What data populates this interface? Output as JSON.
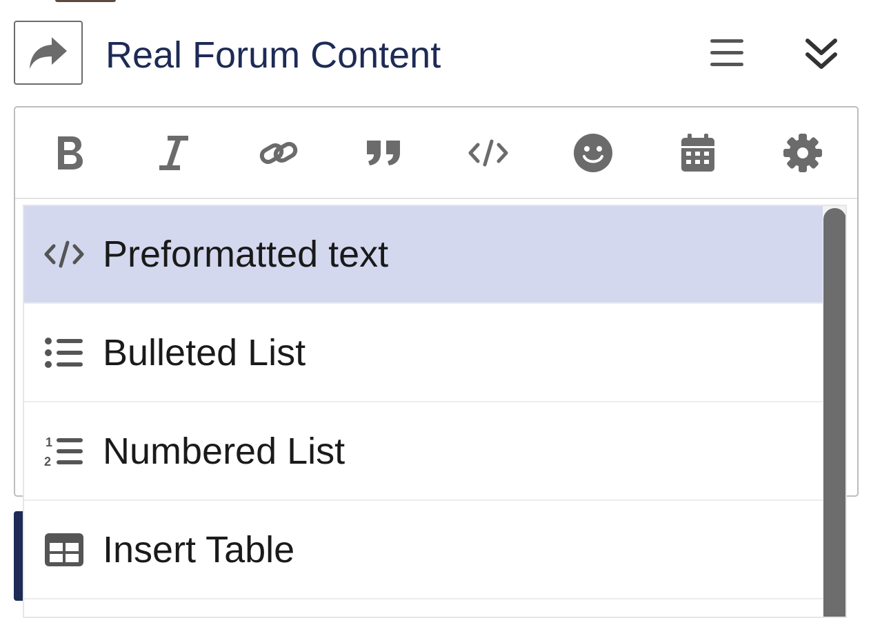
{
  "header": {
    "title": "Real Forum Content",
    "reply_icon": "share-arrow-icon",
    "menu_icon": "hamburger-icon",
    "collapse_icon": "double-chevron-down-icon"
  },
  "toolbar": {
    "buttons": [
      {
        "name": "bold-icon"
      },
      {
        "name": "italic-icon"
      },
      {
        "name": "link-icon"
      },
      {
        "name": "quote-icon"
      },
      {
        "name": "code-icon"
      },
      {
        "name": "emoji-icon"
      },
      {
        "name": "calendar-icon"
      },
      {
        "name": "gear-icon"
      }
    ]
  },
  "dropdown": {
    "items": [
      {
        "label": "Preformatted text",
        "icon": "code-icon",
        "selected": true
      },
      {
        "label": "Bulleted List",
        "icon": "bulleted-list-icon",
        "selected": false
      },
      {
        "label": "Numbered List",
        "icon": "numbered-list-icon",
        "selected": false
      },
      {
        "label": "Insert Table",
        "icon": "table-icon",
        "selected": false
      }
    ]
  },
  "colors": {
    "title": "#1d2b55",
    "icon": "#6b6b6b",
    "selected_bg": "#d3d8ef",
    "scroll_thumb": "#6d6d6d"
  }
}
